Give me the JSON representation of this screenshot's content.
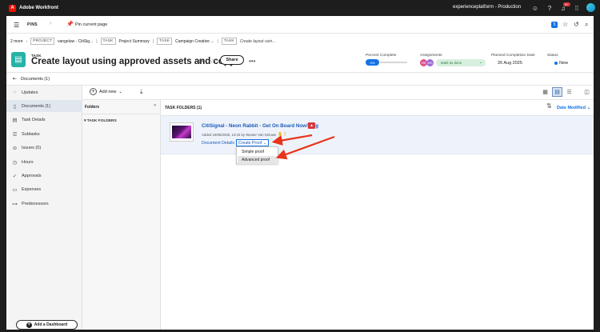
{
  "topbar": {
    "app_name": "Adobe Workfront",
    "org_name": "experienceplatform - Production",
    "notification_count": "9+"
  },
  "pins": {
    "label": "PINS",
    "pin_current": "Pin current page",
    "badge": "5"
  },
  "breadcrumb": {
    "more": "2 more",
    "project_tag": "PROJECT",
    "project_name": "vangeluw - CitiSig...",
    "task_tag1": "TASK",
    "task1_name": "Project Summary",
    "task_tag2": "TASK",
    "task2_name": "Campaign Creative ...",
    "task_tag3": "TASK",
    "task3_name": "Create layout usin..."
  },
  "header": {
    "type": "TASK",
    "title": "Create layout using approved assets and copy",
    "share": "Share",
    "percent_label": "Percent Complete",
    "percent_value": "0%",
    "percent_fraction": 0,
    "assignments_label": "Assignments",
    "assignee1": "SB",
    "assignee2": "WG",
    "mark_done": "Mark as done",
    "planned_label": "Planned Completion Date",
    "planned_value": "26 Aug 2025",
    "status_label": "Status",
    "status_value": "New",
    "colors": {
      "assignee1": "#e2508a",
      "assignee2": "#9c6ad6",
      "status": "#1473e6"
    }
  },
  "docsbar": {
    "label": "Documents (1)"
  },
  "sidebar": {
    "items": [
      {
        "label": "Updates",
        "icon": "chat-bubble-icon"
      },
      {
        "label": "Documents (1)",
        "icon": "document-icon"
      },
      {
        "label": "Task Details",
        "icon": "task-details-icon"
      },
      {
        "label": "Subtasks",
        "icon": "subtasks-icon"
      },
      {
        "label": "Issues (0)",
        "icon": "issues-icon"
      },
      {
        "label": "Hours",
        "icon": "clock-icon"
      },
      {
        "label": "Approvals",
        "icon": "approvals-icon"
      },
      {
        "label": "Expenses",
        "icon": "expenses-icon"
      },
      {
        "label": "Predecessors",
        "icon": "predecessors-icon"
      }
    ],
    "add_dashboard": "Add a Dashboard"
  },
  "toolbar": {
    "add_new": "Add new"
  },
  "folders": {
    "title": "Folders",
    "task_folders": "TASK FOLDERS"
  },
  "main": {
    "heading": "TASK FOLDERS (1)",
    "sort": "Date Modified",
    "document": {
      "name": "CitiSignal - Neon Rabbit - Get On Board Now!.png",
      "added": "Added 19/08/2025, 13:34 by Wouter Van Geluwe",
      "count": "1",
      "details_link": "Document Details",
      "create_proof": "Create Proof",
      "menu": [
        "Simple proof",
        "Advanced proof"
      ]
    }
  }
}
